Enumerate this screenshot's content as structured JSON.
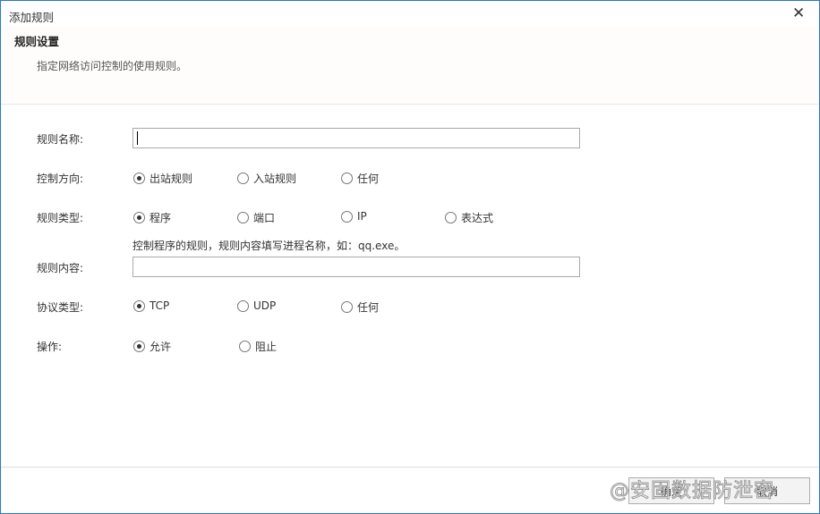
{
  "dialog": {
    "title": "添加规则",
    "close_icon": "close-icon"
  },
  "header": {
    "title": "规则设置",
    "description": "指定网络访问控制的使用规则。"
  },
  "form": {
    "name": {
      "label": "规则名称:",
      "value": ""
    },
    "direction": {
      "label": "控制方向:",
      "options": [
        "出站规则",
        "入站规则",
        "任何"
      ],
      "selected": 0
    },
    "type": {
      "label": "规则类型:",
      "options": [
        "程序",
        "端口",
        "IP",
        "表达式"
      ],
      "selected": 0
    },
    "hint": "控制程序的规则，规则内容填写进程名称，如：qq.exe。",
    "content": {
      "label": "规则内容:",
      "value": ""
    },
    "protocol": {
      "label": "协议类型:",
      "options": [
        "TCP",
        "UDP",
        "任何"
      ],
      "selected": 0
    },
    "action": {
      "label": "操作:",
      "options": [
        "允许",
        "阻止"
      ],
      "selected": 0
    }
  },
  "footer": {
    "ok": "确定",
    "cancel": "取消"
  },
  "watermark": "@安固数据防泄密",
  "colors": {
    "border": "#2b78c8"
  }
}
